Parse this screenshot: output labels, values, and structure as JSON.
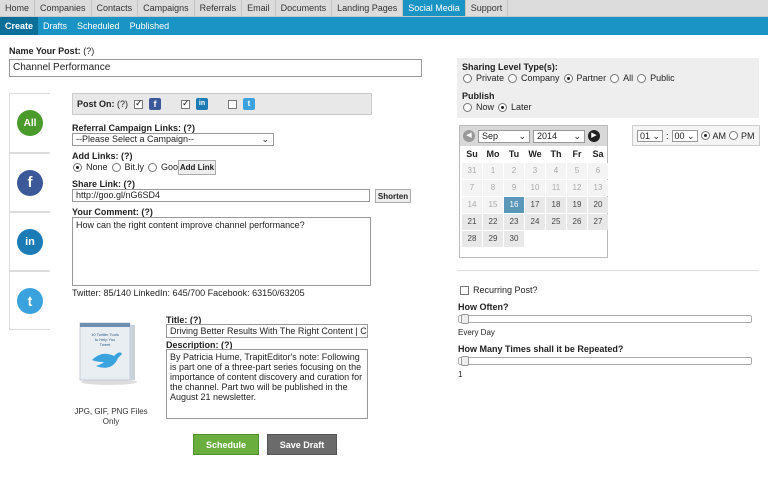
{
  "topnav": [
    "Home",
    "Companies",
    "Contacts",
    "Campaigns",
    "Referrals",
    "Email",
    "Documents",
    "Landing Pages",
    "Social Media",
    "Support"
  ],
  "topnav_active": "Social Media",
  "subnav": [
    "Create",
    "Drafts",
    "Scheduled",
    "Published"
  ],
  "subnav_active": "Create",
  "name_post": {
    "label": "Name Your Post:",
    "help": "(?)",
    "value": "Channel Performance"
  },
  "sidebar": {
    "all": "All",
    "facebook": "f",
    "linkedin": "in",
    "twitter": "t"
  },
  "post_on": {
    "label": "Post On:",
    "help": "(?)",
    "facebook_icon": "f",
    "linkedin_icon": "in",
    "twitter_icon": "t"
  },
  "referral": {
    "label": "Referral Campaign Links: (?)",
    "value": "--Please Select a Campaign--"
  },
  "add_links": {
    "label": "Add Links: (?)",
    "options": [
      "None",
      "Bit.ly",
      "Goo.gl"
    ],
    "selected": "None",
    "button": "Add Link"
  },
  "share_link": {
    "label": "Share Link: (?)",
    "value": "http://goo.gl/nG6SD4",
    "button": "Shorten"
  },
  "comment": {
    "label": "Your Comment: (?)",
    "value": "How can the right content improve channel performance?"
  },
  "counts": "Twitter: 85/140 LinkedIn: 645/700 Facebook: 63150/63205",
  "image": {
    "caption": "JPG, GIF, PNG Files Only",
    "book_title": "10 Twitter Tools to Help You Tweet"
  },
  "title_field": {
    "label": "Title: (?)",
    "value": "Driving Better Results With The Right Content | Cha"
  },
  "description": {
    "label": "Description: (?)",
    "value": "By Patricia Hume, TrapitEditor's note: Following is part one of a three-part series focusing on the importance of content discovery and curation for the channel. Part two will be published in the August 21 newsletter."
  },
  "buttons": {
    "schedule": "Schedule",
    "save_draft": "Save Draft"
  },
  "sharing": {
    "label": "Sharing Level Type(s):",
    "options": [
      "Private",
      "Company",
      "Partner",
      "All",
      "Public"
    ],
    "selected": "Partner"
  },
  "publish": {
    "label": "Publish",
    "options": [
      "Now",
      "Later"
    ],
    "selected": "Later"
  },
  "calendar": {
    "month": "Sep",
    "year": "2014",
    "days": [
      "Su",
      "Mo",
      "Tu",
      "We",
      "Th",
      "Fr",
      "Sa"
    ],
    "cells": [
      {
        "d": "31",
        "s": "dis"
      },
      {
        "d": "1",
        "s": "dis"
      },
      {
        "d": "2",
        "s": "dis"
      },
      {
        "d": "3",
        "s": "dis"
      },
      {
        "d": "4",
        "s": "dis"
      },
      {
        "d": "5",
        "s": "dis"
      },
      {
        "d": "6",
        "s": "dis"
      },
      {
        "d": "7",
        "s": "dis"
      },
      {
        "d": "8",
        "s": "dis"
      },
      {
        "d": "9",
        "s": "dis"
      },
      {
        "d": "10",
        "s": "dis"
      },
      {
        "d": "11",
        "s": "dis"
      },
      {
        "d": "12",
        "s": "dis"
      },
      {
        "d": "13",
        "s": "dis"
      },
      {
        "d": "14",
        "s": "dis"
      },
      {
        "d": "15",
        "s": "dis"
      },
      {
        "d": "16",
        "s": "sel"
      },
      {
        "d": "17",
        "s": ""
      },
      {
        "d": "18",
        "s": ""
      },
      {
        "d": "19",
        "s": ""
      },
      {
        "d": "20",
        "s": ""
      },
      {
        "d": "21",
        "s": ""
      },
      {
        "d": "22",
        "s": ""
      },
      {
        "d": "23",
        "s": ""
      },
      {
        "d": "24",
        "s": ""
      },
      {
        "d": "25",
        "s": ""
      },
      {
        "d": "26",
        "s": ""
      },
      {
        "d": "27",
        "s": ""
      },
      {
        "d": "28",
        "s": ""
      },
      {
        "d": "29",
        "s": ""
      },
      {
        "d": "30",
        "s": ""
      }
    ]
  },
  "time": {
    "hour": "01",
    "minute": "00",
    "ampm": [
      "AM",
      "PM"
    ],
    "selected": "AM"
  },
  "recurring": {
    "label": "Recurring Post?",
    "how_often": "How Often?",
    "how_often_value": "Every Day",
    "how_many": "How Many Times shall it be Repeated?",
    "how_many_value": "1"
  },
  "colors": {
    "accent": "#1a93c5",
    "schedule": "#6aaf3d",
    "save_draft": "#6b6b6b",
    "all_green": "#4a9a2c",
    "facebook": "#3b5998",
    "linkedin": "#1a7bb5",
    "twitter": "#3aa3dd"
  }
}
